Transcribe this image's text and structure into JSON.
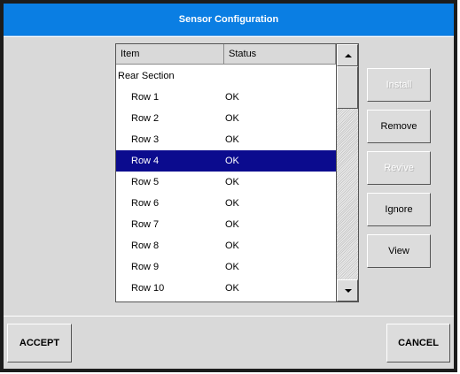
{
  "window": {
    "title": "Sensor Configuration"
  },
  "list": {
    "columns": {
      "item": "Item",
      "status": "Status"
    },
    "rows": [
      {
        "item": "Rear Section",
        "status": "",
        "type": "section",
        "selected": false
      },
      {
        "item": "Row 1",
        "status": "OK",
        "type": "row",
        "selected": false
      },
      {
        "item": "Row 2",
        "status": "OK",
        "type": "row",
        "selected": false
      },
      {
        "item": "Row 3",
        "status": "OK",
        "type": "row",
        "selected": false
      },
      {
        "item": "Row 4",
        "status": "OK",
        "type": "row",
        "selected": true
      },
      {
        "item": "Row 5",
        "status": "OK",
        "type": "row",
        "selected": false
      },
      {
        "item": "Row 6",
        "status": "OK",
        "type": "row",
        "selected": false
      },
      {
        "item": "Row 7",
        "status": "OK",
        "type": "row",
        "selected": false
      },
      {
        "item": "Row 8",
        "status": "OK",
        "type": "row",
        "selected": false
      },
      {
        "item": "Row 9",
        "status": "OK",
        "type": "row",
        "selected": false
      },
      {
        "item": "Row 10",
        "status": "OK",
        "type": "row",
        "selected": false
      }
    ]
  },
  "actions": [
    {
      "name": "install-button",
      "label": "Install",
      "enabled": false
    },
    {
      "name": "remove-button",
      "label": "Remove",
      "enabled": true
    },
    {
      "name": "revive-button",
      "label": "Revive",
      "enabled": false
    },
    {
      "name": "ignore-button",
      "label": "Ignore",
      "enabled": true
    },
    {
      "name": "view-button",
      "label": "View",
      "enabled": true
    }
  ],
  "footer": {
    "accept_label": "ACCEPT",
    "cancel_label": "CANCEL"
  },
  "colors": {
    "title_bar": "#0a7ee3",
    "selection": "#0b0b8e",
    "panel": "#d9d9d9",
    "border": "#1c1c1c"
  },
  "icons": {
    "scroll_up": "triangle-up-icon",
    "scroll_down": "triangle-down-icon"
  }
}
